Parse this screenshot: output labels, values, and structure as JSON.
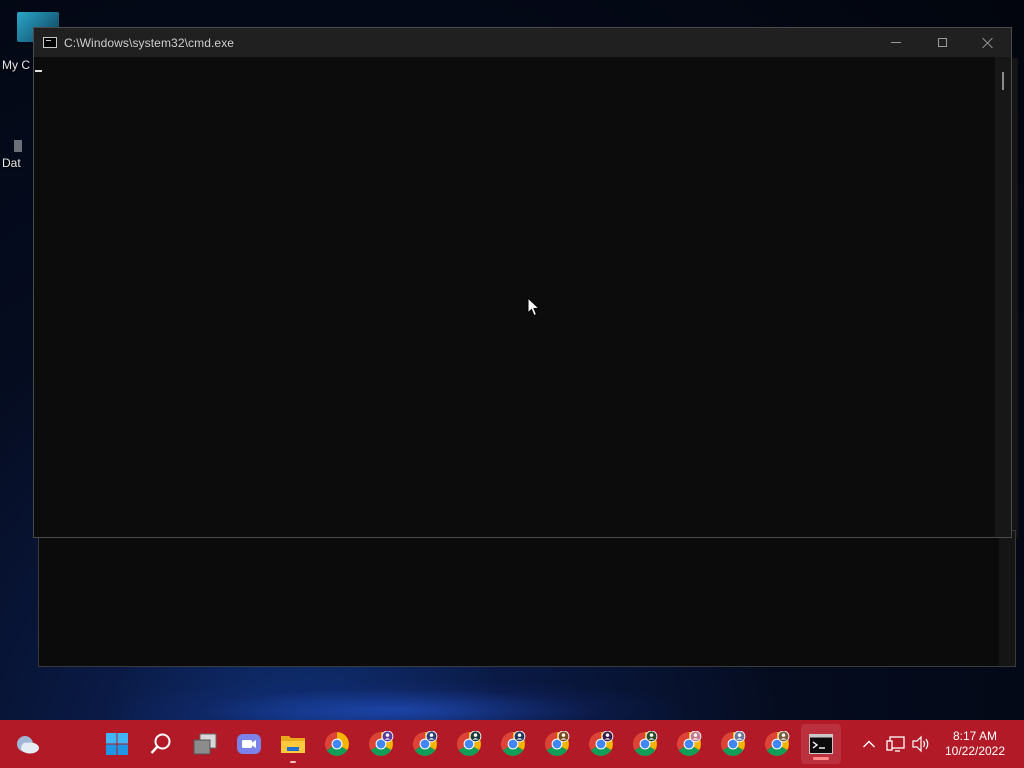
{
  "desktop": {
    "icons": [
      {
        "label": "My C",
        "icon": "monitor-app-icon"
      },
      {
        "label": "Dat",
        "icon": "database-app-icon"
      }
    ]
  },
  "cmd_window": {
    "title": "C:\\Windows\\system32\\cmd.exe",
    "icon": "cmd-icon",
    "console_text": "",
    "controls": {
      "minimize": "minimize-icon",
      "maximize": "maximize-icon",
      "close": "close-icon"
    }
  },
  "taskbar": {
    "background": "#b31a27",
    "items": [
      {
        "name": "weather-widget",
        "icon": "weather-cloud-icon"
      },
      {
        "name": "start",
        "icon": "windows-logo-icon"
      },
      {
        "name": "search",
        "icon": "search-icon"
      },
      {
        "name": "task-view",
        "icon": "task-view-icon"
      },
      {
        "name": "teams-chat",
        "icon": "video-chat-icon"
      },
      {
        "name": "file-explorer",
        "icon": "folder-icon"
      },
      {
        "name": "chrome",
        "icon": "chrome-icon"
      },
      {
        "name": "chrome-profile-1",
        "icon": "chrome-profile-icon"
      },
      {
        "name": "chrome-profile-2",
        "icon": "chrome-profile-icon"
      },
      {
        "name": "chrome-profile-3",
        "icon": "chrome-profile-icon"
      },
      {
        "name": "chrome-profile-4",
        "icon": "chrome-profile-icon"
      },
      {
        "name": "chrome-profile-5",
        "icon": "chrome-profile-icon"
      },
      {
        "name": "chrome-profile-6",
        "icon": "chrome-profile-icon"
      },
      {
        "name": "chrome-profile-7",
        "icon": "chrome-profile-icon"
      },
      {
        "name": "chrome-profile-8",
        "icon": "chrome-profile-icon"
      },
      {
        "name": "chrome-profile-9",
        "icon": "chrome-profile-icon"
      },
      {
        "name": "chrome-profile-10",
        "icon": "chrome-profile-icon"
      },
      {
        "name": "command-prompt",
        "icon": "cmd-icon",
        "active": true
      }
    ],
    "tray": {
      "icons": [
        "chevron-up-icon",
        "network-icon",
        "volume-icon"
      ],
      "time": "8:17 AM",
      "date": "10/22/2022"
    }
  }
}
